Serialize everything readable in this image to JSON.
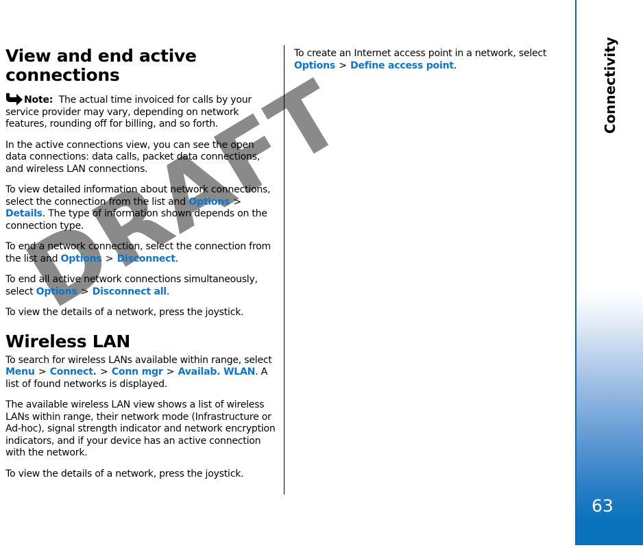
{
  "document": {
    "page_number": "63",
    "section_label": "Connectivity",
    "watermark": "DRAFT",
    "link_color": "#0d74cf",
    "sidebar_accent_color": "#0a72bb"
  },
  "left_column": {
    "heading": "View and end active connections",
    "note": {
      "icon": "note-arrow-icon",
      "label": "Note:",
      "text": "The actual time invoiced for calls by your service provider may vary, depending on network features, rounding off for billing, and so forth."
    },
    "paragraphs": [
      {
        "id": "active-connections-view",
        "text": "In the active connections view, you can see the open data connections: data calls, packet data connections, and wireless LAN connections."
      },
      {
        "id": "view-detailed-information",
        "parts": [
          {
            "type": "text",
            "value": "To view detailed information about network connections, select the connection from the list and "
          },
          {
            "type": "link",
            "value": "Options"
          },
          {
            "type": "sep",
            "value": ">"
          },
          {
            "type": "link",
            "value": "Details"
          },
          {
            "type": "text",
            "value": ". The type of information shown depends on the connection type."
          }
        ]
      },
      {
        "id": "end-network-connection",
        "parts": [
          {
            "type": "text",
            "value": "To end a network connection, select the connection from the list and "
          },
          {
            "type": "link",
            "value": "Options"
          },
          {
            "type": "sep",
            "value": ">"
          },
          {
            "type": "link",
            "value": "Disconnect"
          },
          {
            "type": "text",
            "value": "."
          }
        ]
      },
      {
        "id": "end-all-connections",
        "parts": [
          {
            "type": "text",
            "value": "To end all active network connections simultaneously, select "
          },
          {
            "type": "link",
            "value": "Options"
          },
          {
            "type": "sep",
            "value": ">"
          },
          {
            "type": "link",
            "value": "Disconnect all"
          },
          {
            "type": "text",
            "value": "."
          }
        ]
      },
      {
        "id": "view-details-joystick-1",
        "text": "To view the details of a network, press the joystick."
      }
    ],
    "heading_2": "Wireless LAN",
    "paragraphs_2": [
      {
        "id": "search-wireless-lans",
        "parts": [
          {
            "type": "text",
            "value": "To search for wireless LANs available within range, select "
          },
          {
            "type": "link",
            "value": "Menu"
          },
          {
            "type": "sep",
            "value": ">"
          },
          {
            "type": "link",
            "value": "Connect."
          },
          {
            "type": "sep",
            "value": ">"
          },
          {
            "type": "link",
            "value": "Conn mgr"
          },
          {
            "type": "sep",
            "value": ">"
          },
          {
            "type": "link",
            "value": "Availab. WLAN"
          },
          {
            "type": "text",
            "value": ". A list of found networks is displayed."
          }
        ]
      },
      {
        "id": "available-wlan-view",
        "text": "The available wireless LAN view shows a list of wireless LANs within range, their network mode (Infrastructure or Ad-hoc), signal strength indicator and network encryption indicators, and if your device has an active connection with the network."
      },
      {
        "id": "view-details-joystick-2",
        "text": "To view the details of a network, press the joystick."
      }
    ]
  },
  "right_column": {
    "paragraphs": [
      {
        "id": "create-internet-access-point",
        "parts": [
          {
            "type": "text",
            "value": "To create an Internet access point in a network, select "
          },
          {
            "type": "link",
            "value": "Options"
          },
          {
            "type": "sep",
            "value": ">"
          },
          {
            "type": "link",
            "value": "Define access point"
          },
          {
            "type": "text",
            "value": "."
          }
        ]
      }
    ]
  }
}
